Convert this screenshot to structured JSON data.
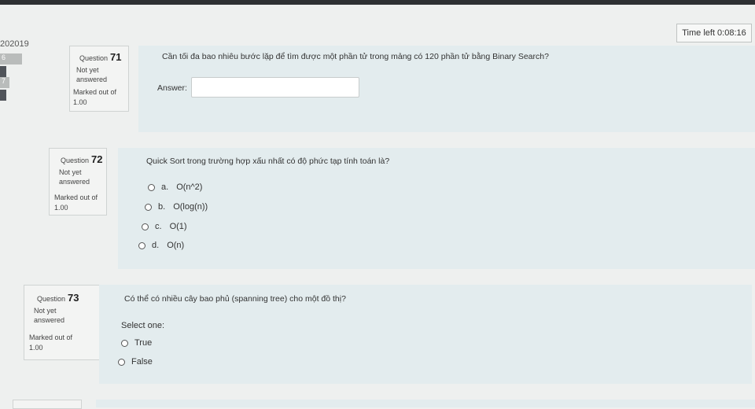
{
  "header": {
    "time_left": "Time left 0:08:16",
    "course_code": "202019"
  },
  "nav": {
    "items": [
      "6",
      "7"
    ]
  },
  "questions": [
    {
      "label": "Question",
      "number": "71",
      "status": [
        "Not yet",
        "answered"
      ],
      "marked": "Marked out of",
      "points": "1.00",
      "text": "Cần tối đa bao nhiêu bước lặp để tìm được một phần tử trong mảng có 120 phần tử bằng Binary Search?",
      "answer_label": "Answer:",
      "answer_value": ""
    },
    {
      "label": "Question",
      "number": "72",
      "status": [
        "Not yet",
        "answered"
      ],
      "marked": "Marked out of",
      "points": "1.00",
      "text": "Quick Sort trong trường hợp xấu nhất có độ phức tạp tính toán là?",
      "options": [
        {
          "letter": "a.",
          "text": "O(n^2)"
        },
        {
          "letter": "b.",
          "text": "O(log(n))"
        },
        {
          "letter": "c.",
          "text": "O(1)"
        },
        {
          "letter": "d.",
          "text": "O(n)"
        }
      ]
    },
    {
      "label": "Question",
      "number": "73",
      "status": [
        "Not yet",
        "answered"
      ],
      "marked": "Marked out of",
      "points": "1.00",
      "text": "Có thể có nhiều cây bao phủ (spanning tree) cho một đồ thị?",
      "select_label": "Select one:",
      "options": [
        {
          "text": "True"
        },
        {
          "text": "False"
        }
      ]
    }
  ]
}
